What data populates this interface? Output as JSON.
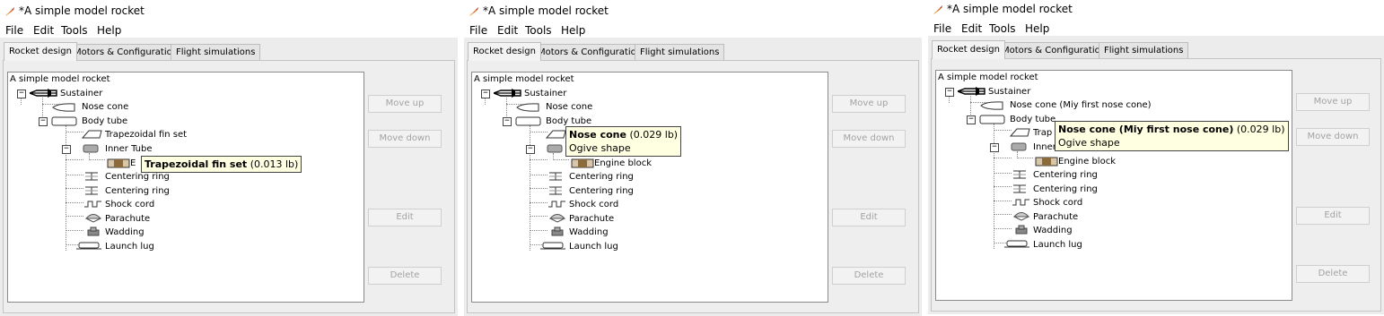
{
  "app_title": "*A simple model rocket",
  "menu": [
    "File",
    "Edit",
    "Tools",
    "Help"
  ],
  "tabs": [
    "Rocket design",
    "Motors & Configuration",
    "Flight simulations"
  ],
  "buttons": {
    "move_up": "Move up",
    "move_down": "Move down",
    "edit": "Edit",
    "delete": "Delete"
  },
  "tree": {
    "root": "A simple model rocket",
    "sustainer": "Sustainer",
    "body_tube": "Body tube",
    "fin_set": "Trapezoidal fin set",
    "inner_tube": "Inner Tube",
    "engine_block": "Engine block",
    "centering_ring": "Centering ring",
    "shock_cord": "Shock cord",
    "parachute": "Parachute",
    "wadding": "Wadding",
    "launch_lug": "Launch lug"
  },
  "panels": [
    {
      "nose_label": "Nose cone",
      "fin_label": "Trapezoidal fin set",
      "inner_label": "Inner Tube",
      "engine_label": "E",
      "tooltip": {
        "name": "Trapezoidal fin set",
        "mass": "(0.013 lb)",
        "detail": ""
      }
    },
    {
      "nose_label": "Nose cone",
      "fin_label": "",
      "inner_label": "",
      "engine_label": "Engine block",
      "tooltip": {
        "name": "Nose cone",
        "mass": "(0.029 lb)",
        "detail": "Ogive shape"
      }
    },
    {
      "nose_label": "Nose cone (Miy first nose cone)",
      "fin_label": "Trap",
      "inner_label": "Inner",
      "engine_label": "Engine block",
      "tooltip": {
        "name": "Nose cone (Miy first nose cone)",
        "mass": "(0.029 lb)",
        "detail": "Ogive shape"
      }
    }
  ]
}
